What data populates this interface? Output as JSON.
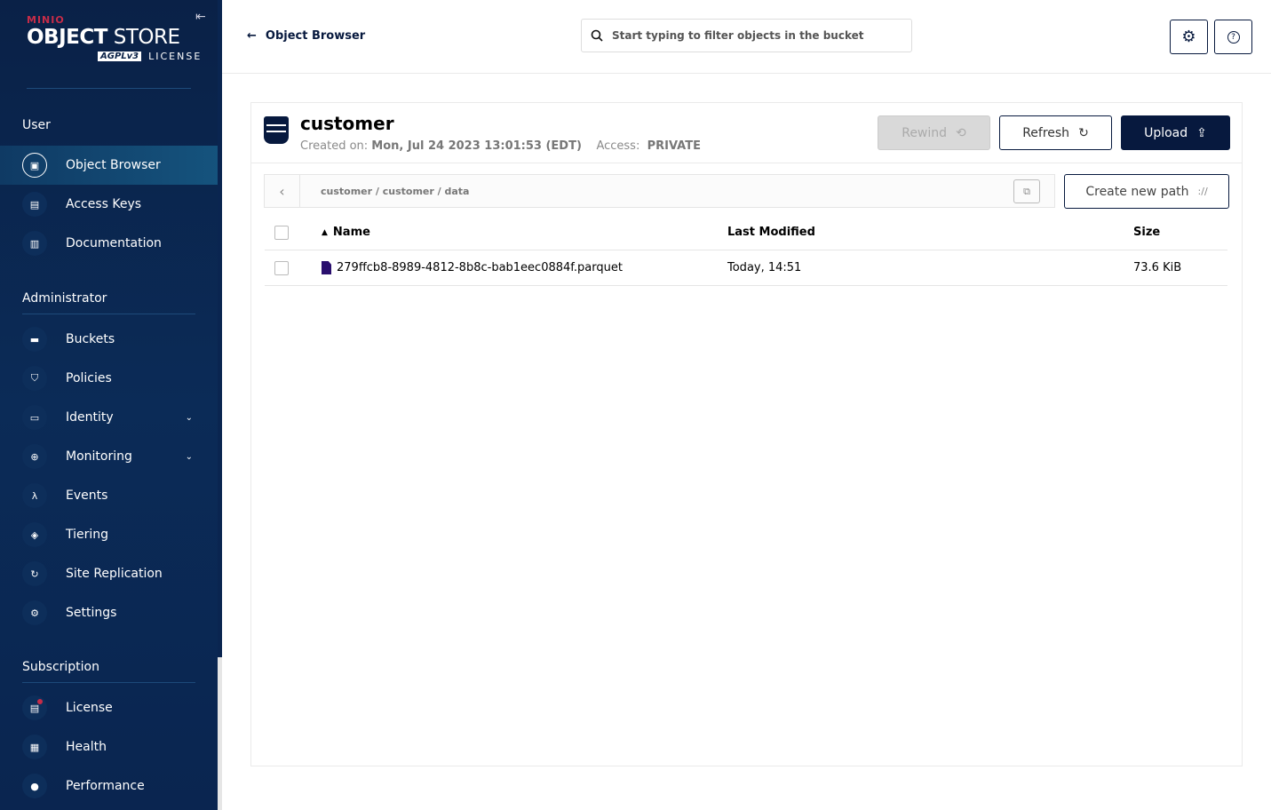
{
  "sidebar": {
    "brand": {
      "minio": "MINIO",
      "object": "OBJECT",
      "store": "STORE",
      "agpl": "AGPLv3",
      "license": "LICENSE"
    },
    "sections": [
      {
        "title": "User",
        "items": [
          {
            "label": "Object Browser",
            "icon": "object-browser-icon",
            "active": true
          },
          {
            "label": "Access Keys",
            "icon": "access-keys-icon"
          },
          {
            "label": "Documentation",
            "icon": "documentation-icon"
          }
        ]
      },
      {
        "title": "Administrator",
        "items": [
          {
            "label": "Buckets",
            "icon": "bucket-icon"
          },
          {
            "label": "Policies",
            "icon": "shield-icon"
          },
          {
            "label": "Identity",
            "icon": "identity-icon",
            "expandable": true
          },
          {
            "label": "Monitoring",
            "icon": "monitoring-icon",
            "expandable": true
          },
          {
            "label": "Events",
            "icon": "lambda-icon"
          },
          {
            "label": "Tiering",
            "icon": "layers-icon"
          },
          {
            "label": "Site Replication",
            "icon": "replication-icon"
          },
          {
            "label": "Settings",
            "icon": "gear-icon"
          }
        ]
      },
      {
        "title": "Subscription",
        "items": [
          {
            "label": "License",
            "icon": "license-icon"
          },
          {
            "label": "Health",
            "icon": "health-icon"
          },
          {
            "label": "Performance",
            "icon": "performance-icon"
          }
        ]
      }
    ]
  },
  "topbar": {
    "back_label": "Object Browser",
    "search_placeholder": "Start typing to filter objects in the bucket"
  },
  "bucket": {
    "name": "customer",
    "created_label": "Created on:",
    "created": "Mon, Jul 24 2023 13:01:53 (EDT)",
    "access_label": "Access:",
    "access": "PRIVATE"
  },
  "buttons": {
    "rewind": "Rewind",
    "refresh": "Refresh",
    "upload": "Upload",
    "create_path": "Create new path"
  },
  "breadcrumb": "customer / customer / data",
  "table": {
    "headers": {
      "name": "Name",
      "modified": "Last Modified",
      "size": "Size"
    },
    "rows": [
      {
        "name": "279ffcb8-8989-4812-8b8c-bab1eec0884f.parquet",
        "modified": "Today, 14:51",
        "size": "73.6 KiB"
      }
    ]
  },
  "colors": {
    "navy": "#07193e",
    "sidebar": "#0a2147",
    "accent_red": "#c72c48"
  }
}
